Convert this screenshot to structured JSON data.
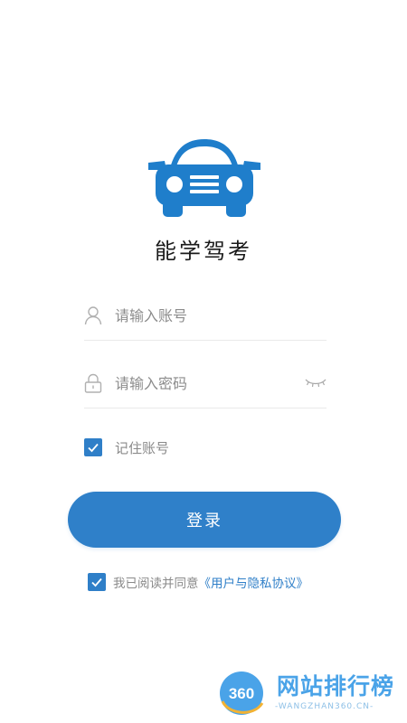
{
  "app": {
    "title": "能学驾考",
    "logo_icon": "car-icon",
    "brand_color": "#1f7ecb"
  },
  "login_form": {
    "account": {
      "placeholder": "请输入账号",
      "value": "",
      "icon": "user-icon"
    },
    "password": {
      "placeholder": "请输入密码",
      "value": "",
      "icon": "lock-icon",
      "toggle_icon": "eye-closed-icon"
    },
    "remember": {
      "label": "记住账号",
      "checked": true
    },
    "login_button": {
      "label": "登录",
      "color": "#2f80c9"
    },
    "agreement": {
      "prefix": "我已阅读并同意",
      "link": "《用户与隐私协议》",
      "checked": true
    }
  },
  "watermark": {
    "badge": "360",
    "title": "网站排行榜",
    "subtitle": "-WANGZHAN360.CN-"
  }
}
